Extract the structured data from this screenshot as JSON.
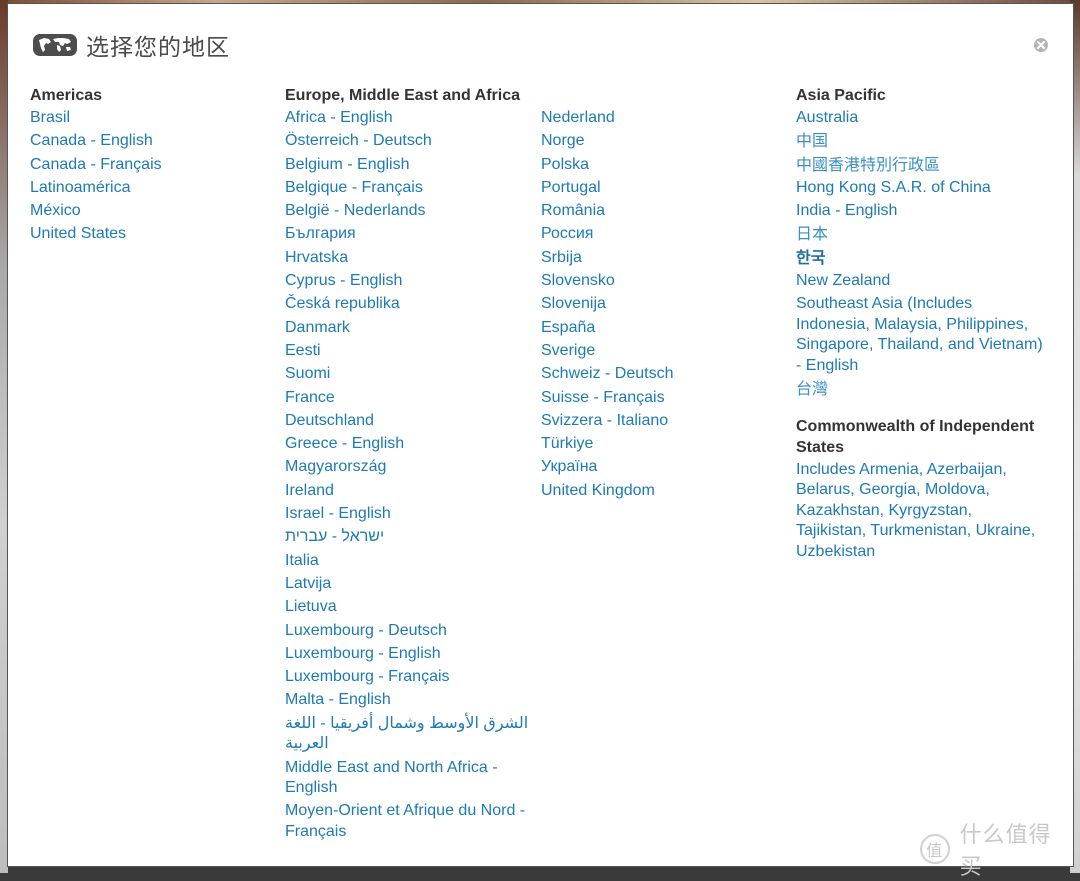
{
  "dialog": {
    "title": "选择您的地区",
    "title_icon": "world-map-icon",
    "close_icon": "close-icon"
  },
  "regions": {
    "americas": {
      "heading": "Americas",
      "items": [
        "Brasil",
        "Canada - English",
        "Canada - Français",
        "Latinoamérica",
        "México",
        "United States"
      ]
    },
    "emea": {
      "heading": "Europe, Middle East and Africa",
      "column1": [
        "Africa - English",
        "Österreich - Deutsch",
        "Belgium - English",
        "Belgique - Français",
        "België - Nederlands",
        "България",
        "Hrvatska",
        "Cyprus - English",
        "Česká republika",
        "Danmark",
        "Eesti",
        "Suomi",
        "France",
        "Deutschland",
        "Greece - English",
        "Magyarország",
        "Ireland",
        "Israel - English",
        "ישראל - עברית",
        "Italia",
        "Latvija",
        "Lietuva",
        "Luxembourg - Deutsch",
        "Luxembourg - English",
        "Luxembourg - Français",
        "Malta - English",
        "الشرق الأوسط وشمال أفريقيا - اللغة العربية",
        "Middle East and North Africa - English",
        "Moyen-Orient et Afrique du Nord - Français"
      ],
      "column2": [
        "Nederland",
        "Norge",
        "Polska",
        "Portugal",
        "România",
        "Россия",
        "Srbija",
        "Slovensko",
        "Slovenija",
        "España",
        "Sverige",
        "Schweiz - Deutsch",
        "Suisse - Français",
        "Svizzera - Italiano",
        "Türkiye",
        "Україна",
        "United Kingdom"
      ]
    },
    "apac": {
      "heading": "Asia Pacific",
      "items": [
        "Australia",
        "中国",
        "中國香港特別行政區",
        "Hong Kong S.A.R. of China",
        "India - English",
        "日本",
        "한국",
        "New Zealand",
        "Southeast Asia (Includes Indonesia, Malaysia, Philippines, Singapore, Thailand, and Vietnam) - English",
        "台灣"
      ]
    },
    "cis": {
      "heading": "Commonwealth of Independent States",
      "items": [
        "Includes Armenia, Azerbaijan, Belarus, Georgia, Moldova, Kazakhstan, Kyrgyzstan, Tajikistan, Turkmenistan, Ukraine, Uzbekistan"
      ]
    }
  },
  "watermark": {
    "badge": "值",
    "text": "什么值得买"
  },
  "colors": {
    "link": "#1d7ab4",
    "heading": "#333333",
    "title": "#4a4a4a"
  }
}
